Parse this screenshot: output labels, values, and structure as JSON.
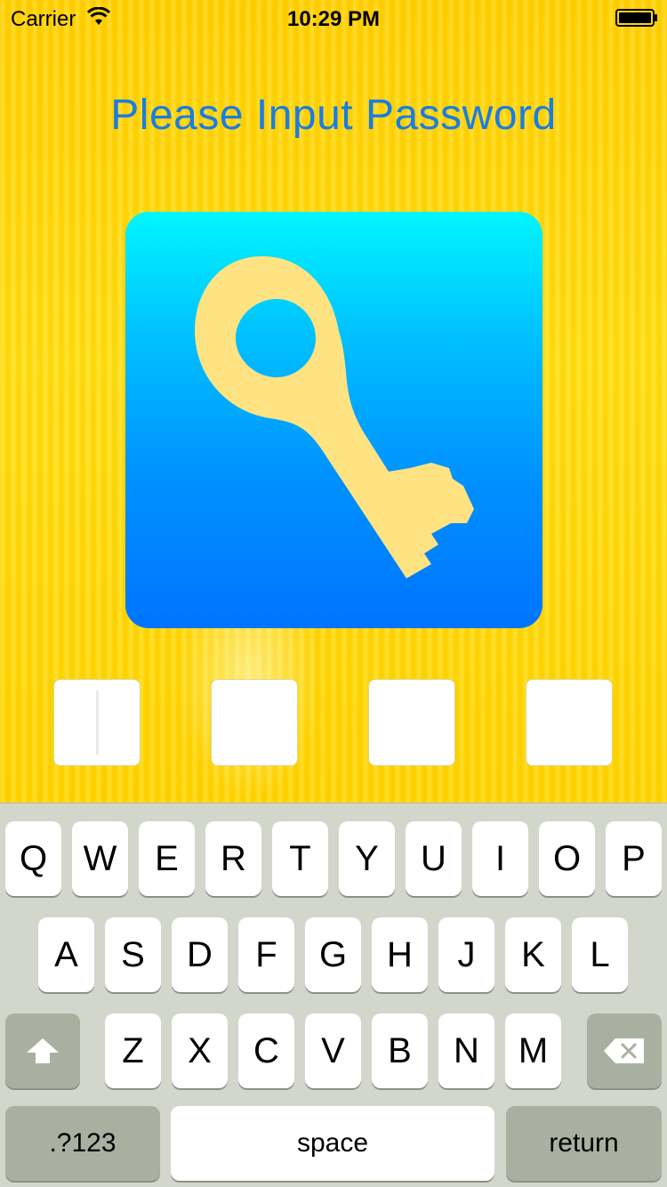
{
  "status_bar": {
    "carrier": "Carrier",
    "time": "10:29 PM",
    "wifi_icon": "wifi-icon",
    "battery_icon": "battery-full-icon"
  },
  "screen": {
    "title": "Please Input Password",
    "icon": "key-icon",
    "pin_slots": 4
  },
  "keyboard": {
    "row1": [
      "Q",
      "W",
      "E",
      "R",
      "T",
      "Y",
      "U",
      "I",
      "O",
      "P"
    ],
    "row2": [
      "A",
      "S",
      "D",
      "F",
      "G",
      "H",
      "J",
      "K",
      "L"
    ],
    "row3": [
      "Z",
      "X",
      "C",
      "V",
      "B",
      "N",
      "M"
    ],
    "shift_icon": "shift-arrow-icon",
    "delete_icon": "backspace-icon",
    "numbers_label": ".?123",
    "space_label": "space",
    "return_label": "return"
  },
  "colors": {
    "background": "#ffd200",
    "title": "#1a7de0",
    "tile_top": "#00f6ff",
    "tile_bottom": "#0074ff",
    "key_fill": "#ffe080",
    "keyboard_bg": "#d3d6cb"
  }
}
